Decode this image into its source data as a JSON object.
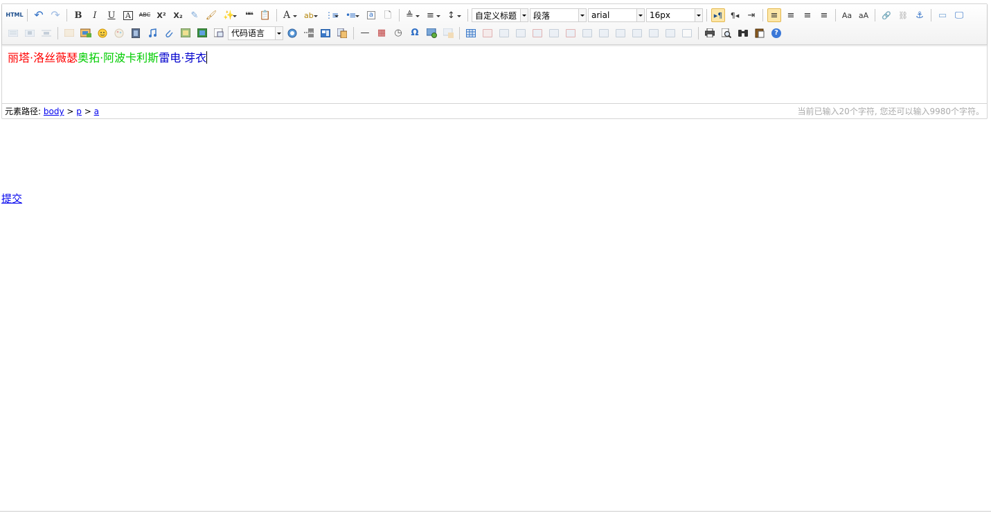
{
  "toolbar": {
    "row1": {
      "html_label": "HTML",
      "undo": "↶",
      "redo": "↷",
      "bold": "B",
      "italic": "I",
      "underline": "U",
      "fontborder": "A",
      "strike": "ABC",
      "superscript": "X²",
      "subscript": "X₂",
      "removeformat": "✎",
      "formatmatch": "🖌",
      "autotypeset": "✨",
      "blockquote": "❝❝",
      "pasteplain": "📋",
      "forecolor": "A",
      "backcolor": "ab",
      "orderedlist": "⋮≡",
      "unorderedlist": "•≡",
      "selectall": "a",
      "cleardoc": "🗋",
      "rowspacingtop": "≜",
      "rowspacingbottom": "≡",
      "lineheight": "↕",
      "customstyle_value": "自定义标题",
      "paragraph_value": "段落",
      "fontfamily_value": "arial",
      "fontsize_value": "16px",
      "ltr": "▸¶",
      "rtl": "¶◂",
      "indent": "⇥",
      "justifyleft": "≡",
      "justifycenter": "≡",
      "justifyright": "≡",
      "justifyjustify": "≡",
      "touppercase": "Aa",
      "tolowercase": "aA",
      "link": "🔗",
      "unlink": "⛓",
      "anchor": "⚓",
      "pagebreak": "▭",
      "fullscreen": "🖵"
    },
    "row2": {
      "codelang_value": "代码语言",
      "horizontal": "—",
      "date": "▦",
      "time": "◷",
      "spechars": "Ω",
      "help": "?"
    }
  },
  "content": {
    "segments": [
      {
        "text": "丽塔·洛丝薇瑟",
        "color": "#ff0000"
      },
      {
        "text": "奥拓·阿波卡利斯",
        "color": "#00cc00"
      },
      {
        "text": "雷电·芽衣",
        "color": "#0000cc"
      }
    ]
  },
  "statusbar": {
    "path_label": "元素路径:",
    "path": [
      "body",
      "p",
      "a"
    ],
    "separator": ">",
    "wordcount": "当前已输入20个字符, 您还可以输入9980个字符。"
  },
  "submit_label": "提交",
  "colors": {
    "active_bg": "#fde7a8",
    "active_border": "#e3b74e",
    "link": "#0000ee",
    "help_blue": "#3b78d8"
  }
}
